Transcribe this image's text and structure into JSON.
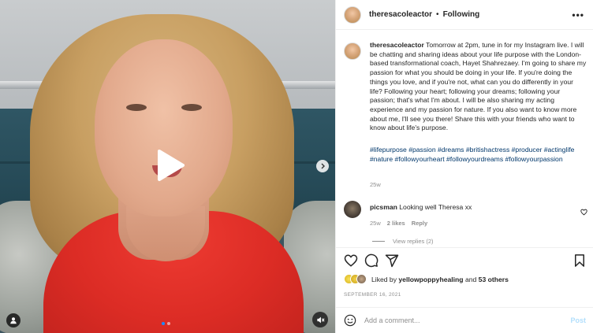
{
  "media": {
    "page_indicator": {
      "count": 2,
      "active": 0
    }
  },
  "header": {
    "username": "theresacoleactor",
    "separator": "•",
    "follow_status": "Following",
    "more_icon": "more-horizontal-icon"
  },
  "caption": {
    "username": "theresacoleactor",
    "text": "Tomorrow at 2pm, tune in for my Instagram live. I will be chatting and sharing ideas about your life purpose with the London-based transformational coach, Hayet Shahrezaey. I'm going to share my passion for what you should be doing in your life. If you're doing the things you love, and if you're not, what can you do differently in your life? Following your heart; following your dreams; following your passion; that's what I'm about. I will be also sharing my acting experience and my passion for nature. If you also want to know more about me, I'll see you there! Share this with your friends who want to know about life's purpose.",
    "hashtags": [
      "#lifepurpose",
      "#passion",
      "#dreams",
      "#britishactress",
      "#producer",
      "#actinglife",
      "#nature",
      "#followyourheart",
      "#followyourdreams",
      "#followyourpassion"
    ],
    "time": "25w"
  },
  "comment": {
    "username": "picsman",
    "text": "Looking well Theresa xx",
    "time": "25w",
    "likes": "2 likes",
    "reply_label": "Reply",
    "view_replies": "View replies (2)"
  },
  "likes": {
    "prefix": "Liked by",
    "user": "yellowpoppyhealing",
    "conjunction": "and",
    "others": "53 others"
  },
  "date": "SEPTEMBER 16, 2021",
  "add_comment": {
    "placeholder": "Add a comment...",
    "post_label": "Post"
  },
  "colors": {
    "link_blue": "#00376b",
    "post_disabled": "#b2dffc",
    "muted": "#8e8e8e",
    "dress_red": "#dc2c25"
  }
}
